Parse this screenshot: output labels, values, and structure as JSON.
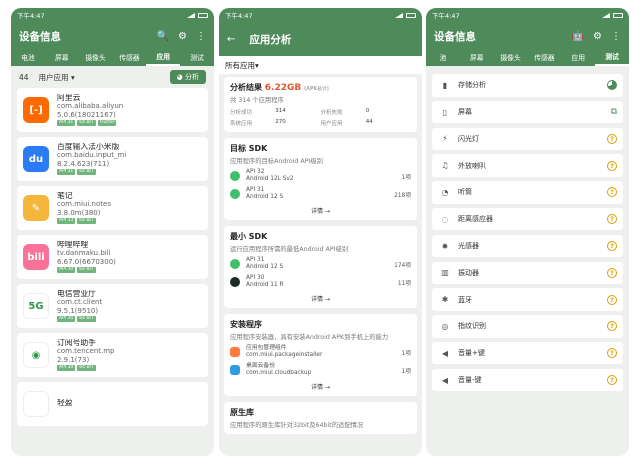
{
  "status": {
    "time": "下午4:47"
  },
  "screen1": {
    "title": "设备信息",
    "tabs": [
      "电池",
      "屏幕",
      "摄像头",
      "传感器",
      "应用",
      "测试"
    ],
    "count": "44",
    "filter": "用户应用",
    "analyze": "分析",
    "apps": [
      {
        "name": "阿里云",
        "pkg": "com.alibaba.aliyun",
        "ver": "5.0.6(18021167)",
        "color": "#ff6a00",
        "glyph": "[-]",
        "badges": [
          "API 31",
          "64 BIT",
          "Flutter"
        ]
      },
      {
        "name": "百度输入法小米版",
        "pkg": "com.baidu.input_mi",
        "ver": "8.2.4.623(711)",
        "color": "#2a7bf4",
        "glyph": "du",
        "badges": [
          "API 31",
          "64 BIT"
        ]
      },
      {
        "name": "笔记",
        "pkg": "com.miui.notes",
        "ver": "3.8.0m(380)",
        "color": "#f3b53a",
        "glyph": "✎",
        "badges": [
          "API 33",
          "64 BIT"
        ]
      },
      {
        "name": "哔哩哔哩",
        "pkg": "tv.danmaku.bili",
        "ver": "6.67.0(6670300)",
        "color": "#fb7299",
        "glyph": "bili",
        "badges": [
          "API 30",
          "64 BIT"
        ]
      },
      {
        "name": "电信营业厅",
        "pkg": "com.ct.client",
        "ver": "9.5.1(9510)",
        "color": "#ffffff",
        "glyph": "5G",
        "badges": [
          "API 30",
          "64 BIT"
        ]
      },
      {
        "name": "订阅号助手",
        "pkg": "com.tencent.mp",
        "ver": "2.9.1(73)",
        "color": "#ffffff",
        "glyph": "◉",
        "badges": [
          "API 30",
          "64 BIT"
        ]
      },
      {
        "name": "轻盈",
        "pkg": "",
        "ver": "",
        "color": "#ffffff",
        "glyph": "",
        "badges": []
      }
    ]
  },
  "screen2": {
    "title": "应用分析",
    "filter": "所有应用",
    "result_title": "分析结果",
    "size": "6.22GB",
    "size_note": "(APK总计)",
    "total": "共 314 个应用程序",
    "stats": [
      {
        "label": "分析成功",
        "value": "314"
      },
      {
        "label": "分析失败",
        "value": "0"
      },
      {
        "label": "系统应用",
        "value": "270"
      },
      {
        "label": "用户应用",
        "value": "44"
      }
    ],
    "target": {
      "title": "目标 SDK",
      "sub": "应用程序的目标Android API级别",
      "rows": [
        {
          "api": "API 32",
          "android": "Android 12L Sv2",
          "count": "1项"
        },
        {
          "api": "API 31",
          "android": "Android 12 S",
          "count": "218项"
        }
      ],
      "detail": "详情 →"
    },
    "min": {
      "title": "最小 SDK",
      "sub": "运行应用程序所需的最低Android API级别",
      "rows": [
        {
          "api": "API 31",
          "android": "Android 12 S",
          "count": "174项"
        },
        {
          "api": "API 30",
          "android": "Android 11 R",
          "count": "11项"
        }
      ],
      "detail": "详情 →"
    },
    "installer": {
      "title": "安装程序",
      "sub": "应用程序安装器，具有安装Android APK到手机上的能力",
      "rows": [
        {
          "api": "应用包管理组件",
          "android": "com.miui.packageinstaller",
          "count": "1项"
        },
        {
          "api": "桌面云备份",
          "android": "com.miui.cloudbackup",
          "count": "1项"
        }
      ],
      "detail": "详情 →"
    },
    "native": {
      "title": "原生库",
      "sub": "应用程序的原生库针对32bit及64bit的适配情况"
    }
  },
  "screen3": {
    "title": "设备信息",
    "tabs": [
      "池",
      "屏幕",
      "摄像头",
      "传感器",
      "应用",
      "测试"
    ],
    "items": [
      "存储分析",
      "屏幕",
      "闪光灯",
      "外放喇叭",
      "听筒",
      "距离感应器",
      "光感器",
      "振动器",
      "蓝牙",
      "指纹识别",
      "音量+键",
      "音量-键"
    ],
    "icons": [
      "▮",
      "▯",
      "⚡",
      "♫",
      "◔",
      "◌",
      "✹",
      "▥",
      "✱",
      "◎",
      "◀",
      "◀"
    ]
  }
}
